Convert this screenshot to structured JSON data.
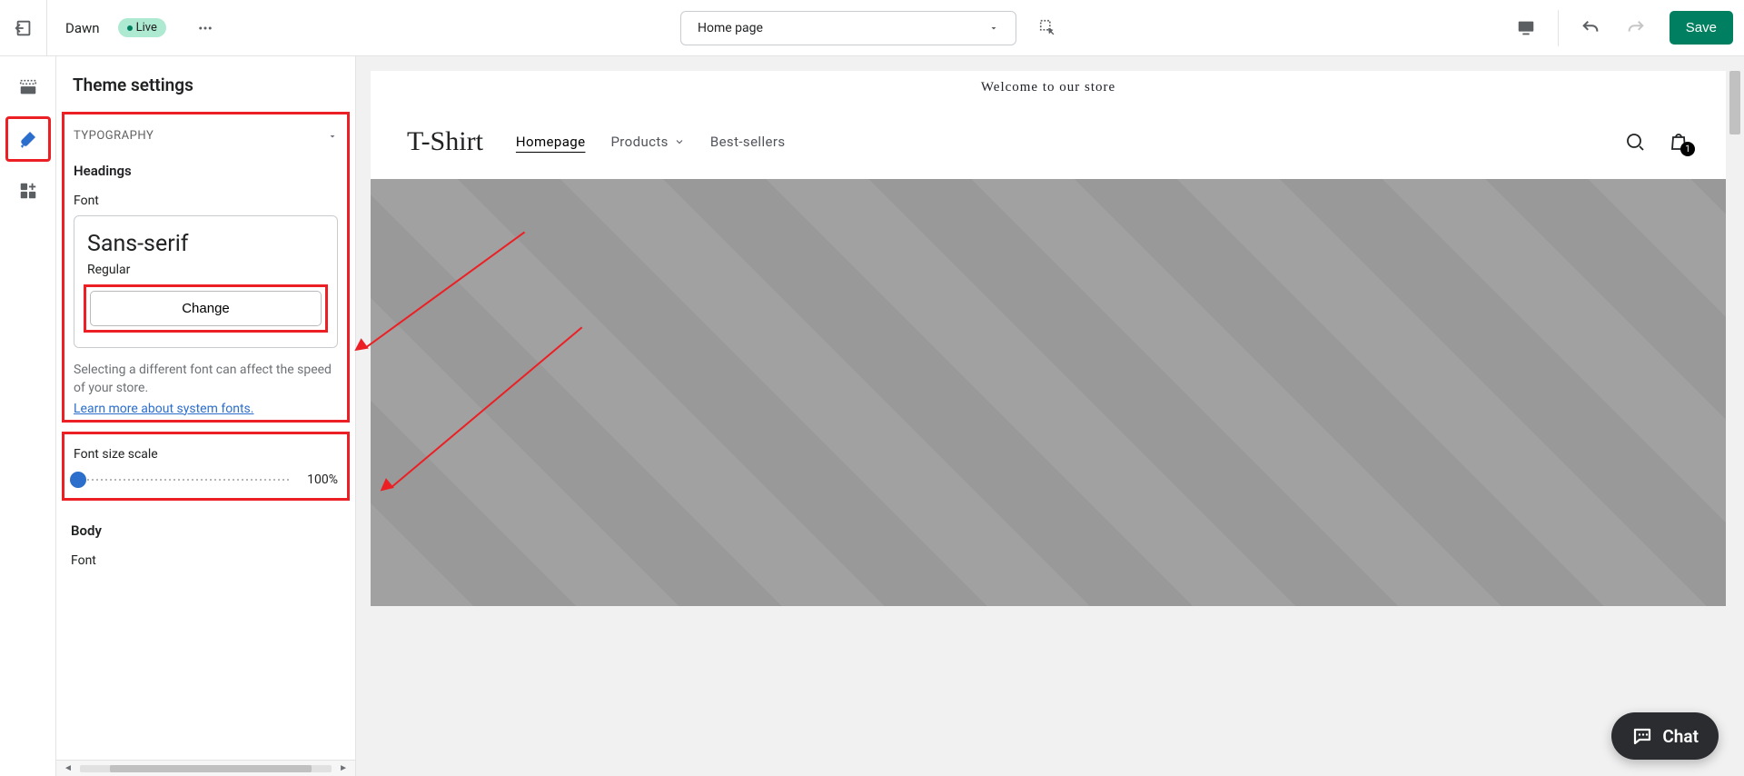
{
  "topbar": {
    "theme_name": "Dawn",
    "status_badge": "Live",
    "page_selector": "Home page",
    "save_label": "Save"
  },
  "sidebar": {
    "title": "Theme settings",
    "section": "TYPOGRAPHY",
    "headings_label": "Headings",
    "font_label": "Font",
    "font_name": "Sans-serif",
    "font_variant": "Regular",
    "change_label": "Change",
    "help_text": "Selecting a different font can affect the speed of your store.",
    "help_link": "Learn more about system fonts.",
    "size_label": "Font size scale",
    "size_value": "100%",
    "body_label": "Body",
    "body_font_label": "Font"
  },
  "preview": {
    "announcement": "Welcome to our store",
    "logo": "T-Shirt",
    "nav": [
      "Homepage",
      "Products",
      "Best-sellers"
    ],
    "cart_count": "1"
  },
  "chat": {
    "label": "Chat"
  }
}
